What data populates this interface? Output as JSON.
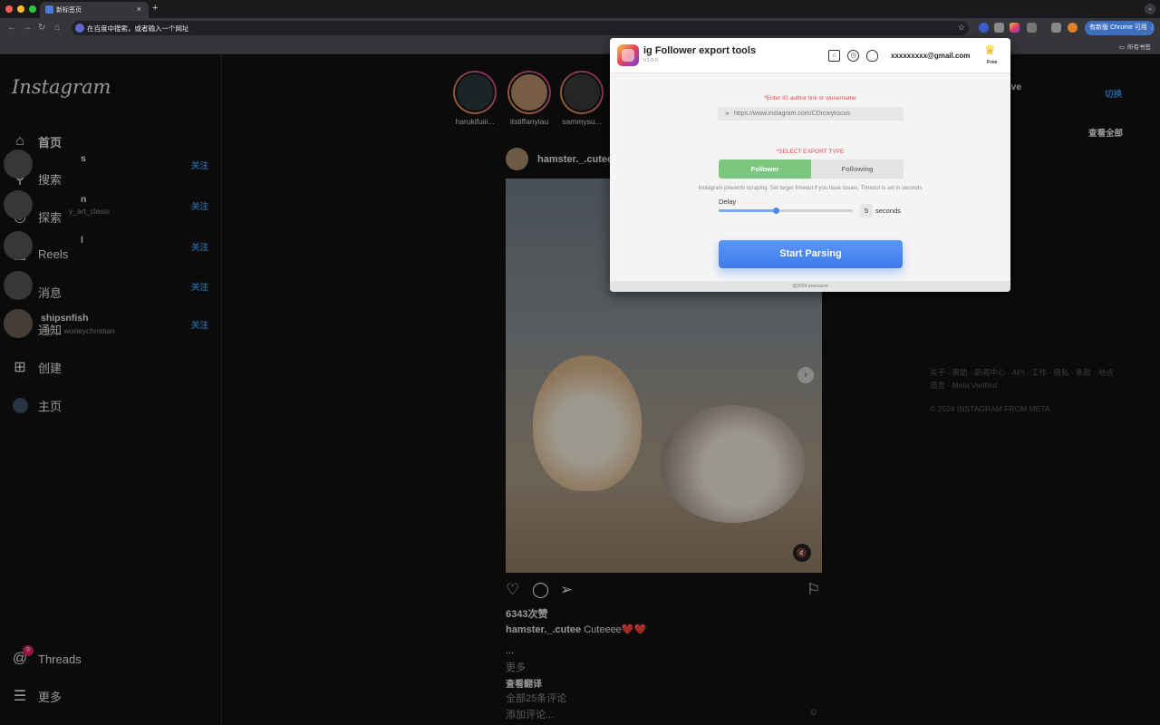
{
  "browser": {
    "tab_title": "新标签页",
    "tab_close": "×",
    "new_tab": "+",
    "tab_menu": "⌄",
    "address_placeholder": "在百度中搜索，或者输入一个网址",
    "update_button": "有新版 Chrome 可用 ⋮",
    "bookmarks_all": "所有书签",
    "nav_back": "←",
    "nav_forward": "→",
    "nav_reload": "↻",
    "nav_home": "⌂",
    "star": "☆",
    "traffic_colors": [
      "#ff5f57",
      "#febc2e",
      "#28c840"
    ]
  },
  "instagram": {
    "logo": "Instagram",
    "nav": [
      {
        "label": "首页",
        "icon": "home-icon",
        "glyph": "⌂"
      },
      {
        "label": "搜索",
        "icon": "search-icon",
        "glyph": "⚲"
      },
      {
        "label": "探索",
        "icon": "compass-icon",
        "glyph": "◎"
      },
      {
        "label": "Reels",
        "icon": "reels-icon",
        "glyph": "▣"
      },
      {
        "label": "消息",
        "icon": "messenger-icon",
        "glyph": "◌"
      },
      {
        "label": "通知",
        "icon": "heart-icon",
        "glyph": "♡"
      },
      {
        "label": "创建",
        "icon": "plus-square-icon",
        "glyph": "⊞"
      },
      {
        "label": "主页",
        "icon": "profile-avatar-icon",
        "glyph": ""
      }
    ],
    "threads": {
      "label": "Threads",
      "badge": "9",
      "glyph": "@"
    },
    "more": {
      "label": "更多",
      "glyph": "☰"
    },
    "stories": [
      "harukifuiii...",
      "itstiffanylau",
      "sammysu..."
    ],
    "post": {
      "username": "hamster._.cutee",
      "likes": "6343次赞",
      "caption_user": "hamster._.cutee",
      "caption_text": " Cuteeee❤️❤️",
      "ellipsis": "...",
      "more": "更多",
      "translate": "查看翻译",
      "all_comments": "全部25条评论",
      "add_comment": "添加评论...",
      "emoji": "☺",
      "actions": {
        "like": "♡",
        "comment": "◯",
        "share": "➢",
        "save": "⚐"
      },
      "next": "›",
      "mute": "🔇"
    },
    "right": {
      "partial_name": "_save",
      "switch": "切换",
      "see_all": "查看全部",
      "suggestions": [
        {
          "name": "s",
          "sub": "",
          "follow": "关注"
        },
        {
          "name": "n",
          "sub": "y_art_classi",
          "follow": "关注"
        },
        {
          "name": "l",
          "sub": "",
          "follow": "关注"
        },
        {
          "name": "",
          "sub": "",
          "follow": "关注"
        },
        {
          "name": "shipsnfish",
          "sub": "粉丝：worleychristian",
          "follow": "关注"
        }
      ],
      "footer": "关于 · 帮助 · 新闻中心 · API · 工作 · 隐私 · 条款 · 地点 · 语言 · Meta Verified",
      "copyright": "© 2024 INSTAGRAM FROM META"
    }
  },
  "popup": {
    "title": "ig Follower export tools",
    "version": "V1.0.0",
    "email": "xxxxxxxxx@gmail.com",
    "plan": "Free",
    "input_label": "*Enter IG author link or wusername",
    "input_placeholder": "https://www.instagram.com/CDrcwykscus",
    "export_label": "*SELECT EXPORT TYPE",
    "type_follower": "Follower",
    "type_following": "Following",
    "hint": "Instagram prevents scraping. Set larger timeout if you have issues. Timeout is set in seconds",
    "delay_label": "Delay",
    "delay_value": "5",
    "delay_unit": "seconds",
    "delay_slider_fraction": 0.43,
    "start_button": "Start Parsing",
    "footer": "@2024 xxxxxame"
  }
}
